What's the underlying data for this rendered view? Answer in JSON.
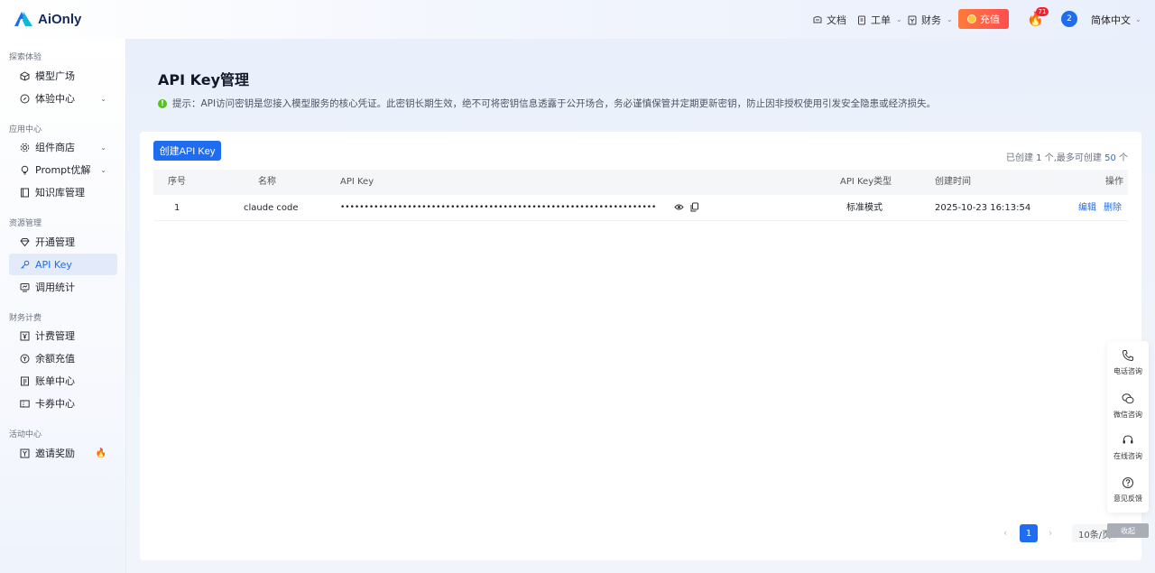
{
  "brand": {
    "name": "AiOnly",
    "color": "#1f6cf0"
  },
  "header": {
    "docs": "文档",
    "tickets": "工单",
    "finance": "财务",
    "recharge": "充值",
    "fire_badge": "71",
    "avatar": "2",
    "language": "简体中文"
  },
  "sidebar": {
    "sections": [
      {
        "title": "探索体验",
        "items": [
          {
            "label": "模型广场",
            "icon": "cube-icon"
          },
          {
            "label": "体验中心",
            "icon": "compass-icon",
            "expandable": true
          }
        ]
      },
      {
        "title": "应用中心",
        "items": [
          {
            "label": "组件商店",
            "icon": "gear-icon",
            "expandable": true
          },
          {
            "label": "Prompt优解",
            "icon": "bulb-icon",
            "expandable": true
          },
          {
            "label": "知识库管理",
            "icon": "book-icon"
          }
        ]
      },
      {
        "title": "资源管理",
        "items": [
          {
            "label": "开通管理",
            "icon": "diamond-icon"
          },
          {
            "label": "API Key",
            "icon": "key-icon",
            "active": true
          },
          {
            "label": "调用统计",
            "icon": "monitor-icon"
          }
        ]
      },
      {
        "title": "财务计费",
        "items": [
          {
            "label": "计费管理",
            "icon": "yen-box-icon"
          },
          {
            "label": "余额充值",
            "icon": "wallet-icon"
          },
          {
            "label": "账单中心",
            "icon": "bill-icon"
          },
          {
            "label": "卡券中心",
            "icon": "ticket-icon"
          }
        ]
      },
      {
        "title": "活动中心",
        "items": [
          {
            "label": "邀请奖励",
            "icon": "gift-icon",
            "hot": true
          }
        ]
      }
    ]
  },
  "main": {
    "title": "API Key管理",
    "tip": "提示：API访问密钥是您接入模型服务的核心凭证。此密钥长期生效，绝不可将密钥信息透露于公开场合，务必谨慎保管并定期更新密钥，防止因非授权使用引发安全隐患或经济损失。",
    "create_button": "创建API Key",
    "quota": {
      "prefix": "已创建 ",
      "created": "1",
      "middle": " 个,最多可创建 ",
      "max": "50",
      "suffix": " 个"
    },
    "table": {
      "columns": [
        "序号",
        "名称",
        "API Key",
        "API Key类型",
        "创建时间",
        "操作"
      ],
      "rows": [
        {
          "index": "1",
          "name": "claude code",
          "key": "••••••••••••••••••••••••••••••••••••••••••••••••••••••••••••••••••",
          "type": "标准模式",
          "created": "2025-10-23 16:13:54",
          "edit": "编辑",
          "delete": "删除"
        }
      ]
    },
    "pagination": {
      "current": "1",
      "page_size": "10条/页"
    }
  },
  "float_panel": {
    "items": [
      "电话咨询",
      "微信咨询",
      "在线咨询",
      "意见反馈"
    ],
    "collapse": "收起"
  }
}
